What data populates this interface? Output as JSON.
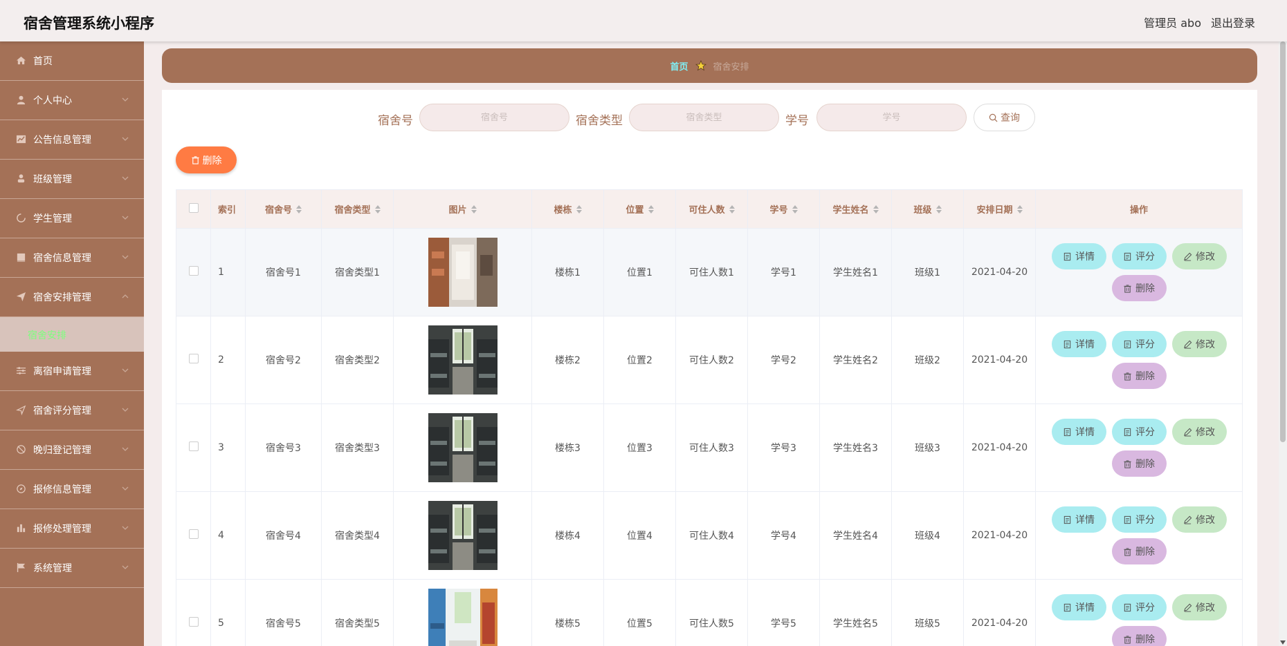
{
  "header": {
    "app_title": "宿舍管理系统小程序",
    "user_label": "管理员 abo",
    "logout_label": "退出登录"
  },
  "sidebar": {
    "items": [
      {
        "label": "首页",
        "icon": "home-icon",
        "has_chevron": false
      },
      {
        "label": "个人中心",
        "icon": "user-icon",
        "has_chevron": true
      },
      {
        "label": "公告信息管理",
        "icon": "chart-icon",
        "has_chevron": true
      },
      {
        "label": "班级管理",
        "icon": "person-icon",
        "has_chevron": true
      },
      {
        "label": "学生管理",
        "icon": "loading-icon",
        "has_chevron": true
      },
      {
        "label": "宿舍信息管理",
        "icon": "book-icon",
        "has_chevron": true
      },
      {
        "label": "宿舍安排管理",
        "icon": "send-icon",
        "has_chevron": true,
        "expanded": true
      },
      {
        "label": "离宿申请管理",
        "icon": "sliders-icon",
        "has_chevron": true
      },
      {
        "label": "宿舍评分管理",
        "icon": "location-icon",
        "has_chevron": true
      },
      {
        "label": "晚归登记管理",
        "icon": "mute-icon",
        "has_chevron": true
      },
      {
        "label": "报修信息管理",
        "icon": "compass-icon",
        "has_chevron": true
      },
      {
        "label": "报修处理管理",
        "icon": "bar-chart-icon",
        "has_chevron": true
      },
      {
        "label": "系统管理",
        "icon": "flag-icon",
        "has_chevron": true
      }
    ],
    "submenu_active": "宿舍安排"
  },
  "breadcrumb": {
    "home": "首页",
    "current": "宿舍安排"
  },
  "search": {
    "dorm_no_label": "宿舍号",
    "dorm_no_placeholder": "宿舍号",
    "dorm_type_label": "宿舍类型",
    "dorm_type_placeholder": "宿舍类型",
    "student_no_label": "学号",
    "student_no_placeholder": "学号",
    "query_label": "查询"
  },
  "toolbar": {
    "delete_label": "删除"
  },
  "table": {
    "columns": [
      "索引",
      "宿舍号",
      "宿舍类型",
      "图片",
      "楼栋",
      "位置",
      "可住人数",
      "学号",
      "学生姓名",
      "班级",
      "安排日期",
      "操作"
    ],
    "rows": [
      {
        "index": "1",
        "dorm_no": "宿舍号1",
        "dorm_type": "宿舍类型1",
        "image": "dorm-photo-hallway",
        "building": "楼栋1",
        "position": "位置1",
        "capacity": "可住人数1",
        "student_no": "学号1",
        "student_name": "学生姓名1",
        "class": "班级1",
        "date": "2021-04-20"
      },
      {
        "index": "2",
        "dorm_no": "宿舍号2",
        "dorm_type": "宿舍类型2",
        "image": "dorm-photo-window",
        "building": "楼栋2",
        "position": "位置2",
        "capacity": "可住人数2",
        "student_no": "学号2",
        "student_name": "学生姓名2",
        "class": "班级2",
        "date": "2021-04-20"
      },
      {
        "index": "3",
        "dorm_no": "宿舍号3",
        "dorm_type": "宿舍类型3",
        "image": "dorm-photo-window",
        "building": "楼栋3",
        "position": "位置3",
        "capacity": "可住人数3",
        "student_no": "学号3",
        "student_name": "学生姓名3",
        "class": "班级3",
        "date": "2021-04-20"
      },
      {
        "index": "4",
        "dorm_no": "宿舍号4",
        "dorm_type": "宿舍类型4",
        "image": "dorm-photo-window",
        "building": "楼栋4",
        "position": "位置4",
        "capacity": "可住人数4",
        "student_no": "学号4",
        "student_name": "学生姓名4",
        "class": "班级4",
        "date": "2021-04-20"
      },
      {
        "index": "5",
        "dorm_no": "宿舍号5",
        "dorm_type": "宿舍类型5",
        "image": "dorm-photo-bright",
        "building": "楼栋5",
        "position": "位置5",
        "capacity": "可住人数5",
        "student_no": "学号5",
        "student_name": "学生姓名5",
        "class": "班级5",
        "date": "2021-04-20"
      }
    ],
    "actions": {
      "detail": "详情",
      "rate": "评分",
      "edit": "修改",
      "delete": "删除"
    }
  },
  "colors": {
    "brand": "#a47157",
    "accent_orange": "#ff7b43",
    "action_cyan": "#a9ecf0",
    "action_green": "#c6e8c6",
    "action_purple": "#d9b8e0"
  }
}
